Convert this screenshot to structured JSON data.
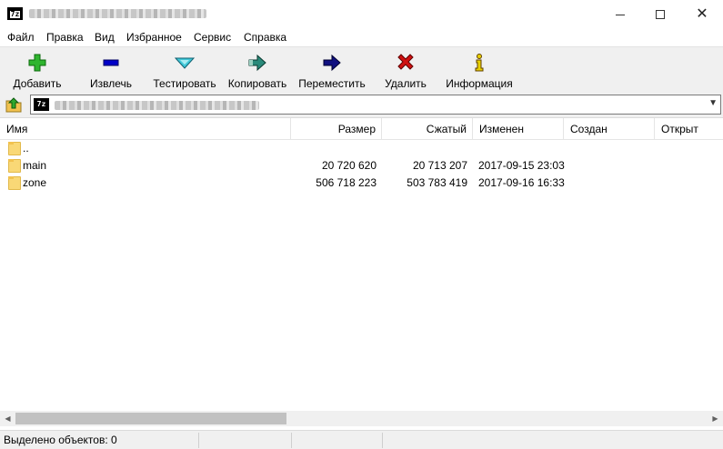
{
  "window": {
    "app_icon_text": "7z"
  },
  "menu": [
    {
      "label": "Файл"
    },
    {
      "label": "Правка"
    },
    {
      "label": "Вид"
    },
    {
      "label": "Избранное"
    },
    {
      "label": "Сервис"
    },
    {
      "label": "Справка"
    }
  ],
  "toolbar": {
    "add": "Добавить",
    "extract": "Извлечь",
    "test": "Тестировать",
    "copy": "Копировать",
    "move": "Переместить",
    "delete": "Удалить",
    "info": "Информация"
  },
  "address": {
    "icon_text": "7z"
  },
  "columns": {
    "name": "Имя",
    "size": "Размер",
    "packed": "Сжатый",
    "modified": "Изменен",
    "created": "Создан",
    "accessed": "Открыт"
  },
  "rows": [
    {
      "name": "..",
      "size": "",
      "packed": "",
      "modified": ""
    },
    {
      "name": "main",
      "size": "20 720 620",
      "packed": "20 713 207",
      "modified": "2017-09-15 23:03"
    },
    {
      "name": "zone",
      "size": "506 718 223",
      "packed": "503 783 419",
      "modified": "2017-09-16 16:33"
    }
  ],
  "status": {
    "selected": "Выделено объектов: 0"
  },
  "colors": {
    "add_icon": "#2fb52f",
    "extract_icon": "#0000c8",
    "test_icon": "#40c8d8",
    "copy_icon": "#2a8a7a",
    "move_icon": "#101080",
    "delete_icon": "#d01010",
    "info_icon": "#e8d000",
    "folder": "#f9d876"
  }
}
